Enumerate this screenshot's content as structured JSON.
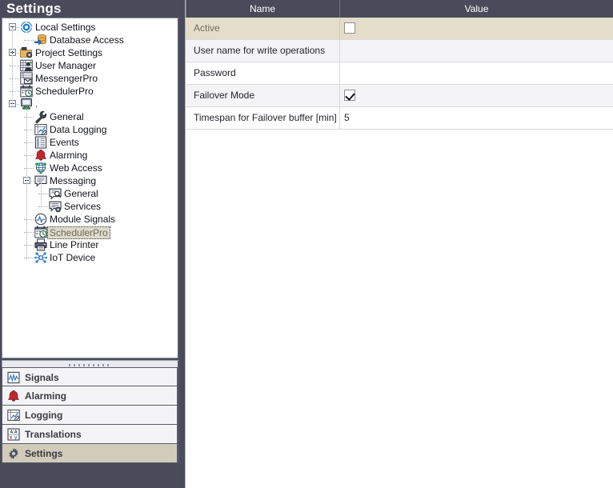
{
  "panel": {
    "title": "Settings"
  },
  "tree": {
    "nodes": [
      {
        "label": "Local Settings",
        "icon": "gear-blue-icon",
        "depth": 0,
        "expander": "minus"
      },
      {
        "label": "Database Access",
        "icon": "database-arrow-icon",
        "depth": 1,
        "expander": "none"
      },
      {
        "label": "Project Settings",
        "icon": "project-folder-icon",
        "depth": 0,
        "expander": "plus"
      },
      {
        "label": "User Manager",
        "icon": "user-manager-icon",
        "depth": 0,
        "expander": "none"
      },
      {
        "label": "MessengerPro",
        "icon": "messenger-icon",
        "depth": 0,
        "expander": "none"
      },
      {
        "label": "SchedulerPro",
        "icon": "scheduler-icon",
        "depth": 0,
        "expander": "none"
      },
      {
        "label": ".",
        "icon": "computer-icon",
        "depth": 0,
        "expander": "minus"
      },
      {
        "label": "General",
        "icon": "wrench-icon",
        "depth": 1,
        "expander": "none"
      },
      {
        "label": "Data Logging",
        "icon": "data-logging-icon",
        "depth": 1,
        "expander": "none"
      },
      {
        "label": "Events",
        "icon": "events-icon",
        "depth": 1,
        "expander": "none"
      },
      {
        "label": "Alarming",
        "icon": "bell-red-icon",
        "depth": 1,
        "expander": "none"
      },
      {
        "label": "Web Access",
        "icon": "globe-icon",
        "depth": 1,
        "expander": "none"
      },
      {
        "label": "Messaging",
        "icon": "message-icon",
        "depth": 1,
        "expander": "minus"
      },
      {
        "label": "General",
        "icon": "message-general-icon",
        "depth": 2,
        "expander": "none"
      },
      {
        "label": "Services",
        "icon": "message-services-icon",
        "depth": 2,
        "expander": "none"
      },
      {
        "label": "Module Signals",
        "icon": "module-signals-icon",
        "depth": 1,
        "expander": "none"
      },
      {
        "label": "SchedulerPro",
        "icon": "scheduler-icon",
        "depth": 1,
        "expander": "none",
        "selected": true
      },
      {
        "label": "Line Printer",
        "icon": "line-printer-icon",
        "depth": 1,
        "expander": "none"
      },
      {
        "label": "IoT Device",
        "icon": "iot-device-icon",
        "depth": 1,
        "expander": "none"
      }
    ]
  },
  "bottom_nav": {
    "items": [
      {
        "label": "Signals",
        "icon": "signals-icon",
        "active": false
      },
      {
        "label": "Alarming",
        "icon": "bell-red-icon",
        "active": false
      },
      {
        "label": "Logging",
        "icon": "logging-icon",
        "active": false
      },
      {
        "label": "Translations",
        "icon": "translations-icon",
        "active": false
      },
      {
        "label": "Settings",
        "icon": "gear-icon",
        "active": true
      }
    ]
  },
  "table": {
    "columns": [
      {
        "key": "name",
        "label": "Name"
      },
      {
        "key": "value",
        "label": "Value"
      }
    ],
    "rows": [
      {
        "name": "Active",
        "value": "",
        "type": "checkbox",
        "checked": false,
        "selected": true,
        "shade": "selected"
      },
      {
        "name": "User name for write operations",
        "value": "",
        "type": "text",
        "checked": false,
        "selected": false,
        "shade": "alt"
      },
      {
        "name": "Password",
        "value": "",
        "type": "text",
        "checked": false,
        "selected": false,
        "shade": "none"
      },
      {
        "name": "Failover Mode",
        "value": "",
        "type": "checkbox",
        "checked": true,
        "selected": false,
        "shade": "alt"
      },
      {
        "name": "Timespan for Failover buffer [min]",
        "value": "5",
        "type": "text",
        "checked": false,
        "selected": false,
        "shade": "none"
      }
    ]
  },
  "colors": {
    "header_bg": "#4a4b5a",
    "selected_row": "#e4ddc9",
    "alt_row": "#f4f4f6",
    "nav_active": "#d1cbba",
    "accent_red": "#c0272d",
    "accent_blue": "#2c7bd4"
  }
}
